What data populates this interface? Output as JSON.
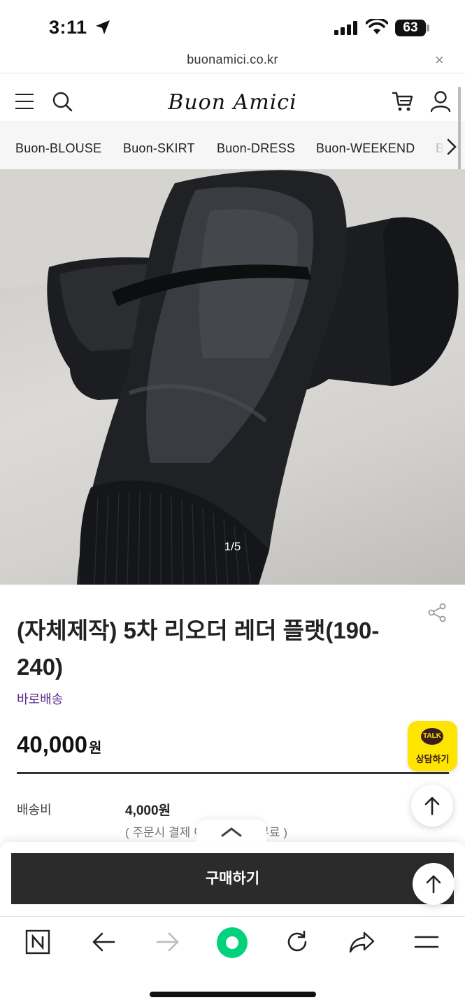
{
  "status_bar": {
    "time": "3:11",
    "battery": "63"
  },
  "browser": {
    "url": "buonamici.co.kr",
    "close_label": "×"
  },
  "site": {
    "logo": "Buon Amici",
    "categories": [
      "Buon-BLOUSE",
      "Buon-SKIRT",
      "Buon-DRESS",
      "Buon-WEEKEND",
      "Bu"
    ]
  },
  "gallery": {
    "counter": "1/5"
  },
  "product": {
    "title": "(자체제작) 5차 리오더 레더 플랫(190-240)",
    "tag": "바로배송",
    "price": "40,000",
    "currency": "원",
    "shipping_label": "배송비",
    "shipping_value": "4,000원",
    "shipping_note": "( 주문시 결제          이상 구매 시 무료 )"
  },
  "kakao": {
    "bubble": "TALK",
    "label": "상담하기"
  },
  "actions": {
    "buy_label": "구매하기"
  }
}
